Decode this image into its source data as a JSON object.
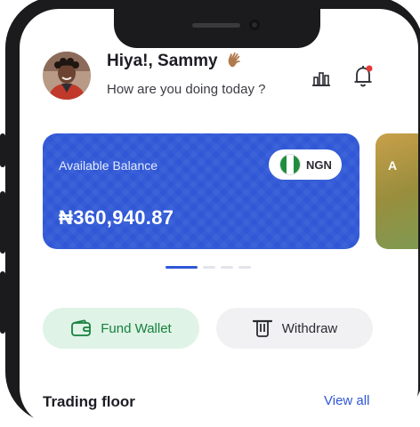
{
  "header": {
    "greeting": "Hiya!, Sammy",
    "subtitle": "How are you doing today ?",
    "icons": [
      "avatar",
      "wave-hand-icon",
      "chart-icon",
      "notification-bell-icon"
    ]
  },
  "balance_card": {
    "label": "Available Balance",
    "amount": "₦360,940.87",
    "currency": "NGN",
    "colors": {
      "card": "#2f57d6",
      "flag_green": "#1e8e3e",
      "flag_white": "#ffffff"
    }
  },
  "next_card_peek": {
    "label_initial": "A"
  },
  "carousel": {
    "pages": 4,
    "active_page": 1
  },
  "actions": {
    "fund_label": "Fund Wallet",
    "withdraw_label": "Withdraw"
  },
  "trading": {
    "title": "Trading floor",
    "view_all": "View all"
  },
  "colors": {
    "accent_blue": "#2f57d6",
    "fund_green": "#17803f",
    "fund_bg": "#dff3e6",
    "notification_dot": "#e53935"
  }
}
